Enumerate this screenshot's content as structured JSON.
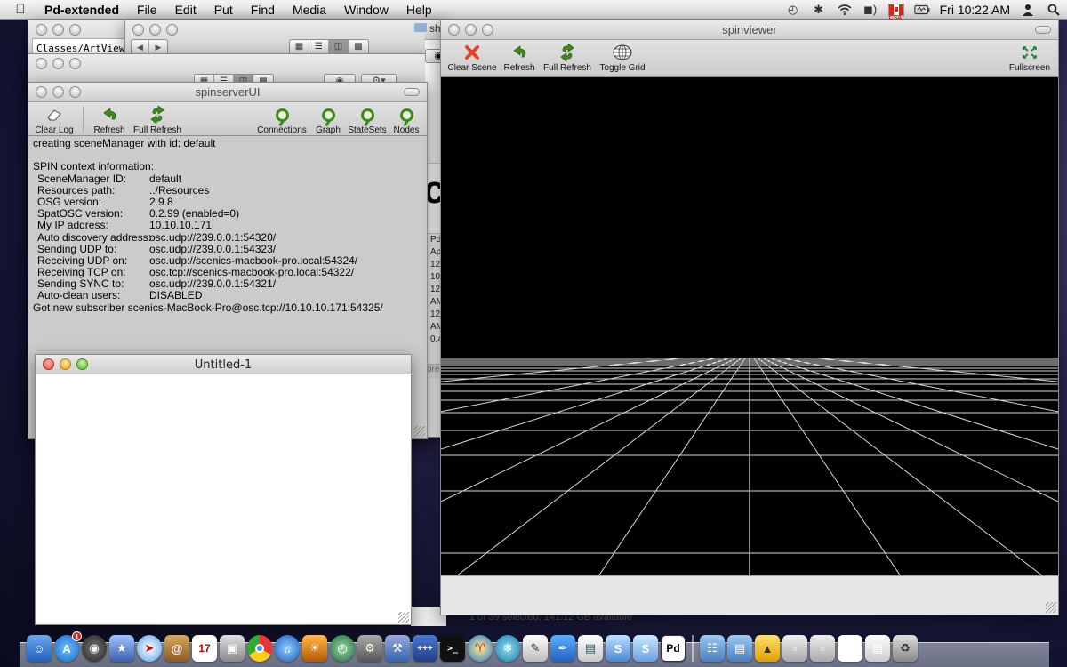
{
  "menubar": {
    "app_name": "Pd-extended",
    "items": [
      "File",
      "Edit",
      "Put",
      "Find",
      "Media",
      "Window",
      "Help"
    ],
    "clock": "Fri 10:22 AM",
    "flag_label": "CSA"
  },
  "finder_back": {
    "tab_label": "Classes/ArtView",
    "sidebar_label": "sh"
  },
  "spinserver": {
    "title": "spinserverUI",
    "toolbar": {
      "clear_log": "Clear Log",
      "refresh": "Refresh",
      "full_refresh": "Full Refresh",
      "connections": "Connections",
      "graph": "Graph",
      "statesets": "StateSets",
      "nodes": "Nodes"
    },
    "log": {
      "line1": "creating sceneManager with id: default",
      "header": "SPIN context information:",
      "entries": [
        {
          "k": "SceneManager ID:",
          "v": "default"
        },
        {
          "k": "Resources path:",
          "v": "../Resources"
        },
        {
          "k": "OSG version:",
          "v": "2.9.8"
        },
        {
          "k": "SpatOSC version:",
          "v": "0.2.99 (enabled=0)"
        },
        {
          "k": "My IP address:",
          "v": "10.10.10.171"
        },
        {
          "k": "Auto discovery address:",
          "v": "osc.udp://239.0.0.1:54320/"
        },
        {
          "k": "Sending UDP to:",
          "v": "osc.udp://239.0.0.1:54323/"
        },
        {
          "k": "Receiving UDP on:",
          "v": "osc.udp://scenics-macbook-pro.local:54324/"
        },
        {
          "k": "Receiving TCP on:",
          "v": "osc.tcp://scenics-macbook-pro.local:54322/"
        },
        {
          "k": "Sending SYNC to:",
          "v": "osc.udp://239.0.0.1:54321/"
        },
        {
          "k": "Auto-clean users:",
          "v": "DISABLED"
        }
      ],
      "footer": "Got new subscriber scenics-MacBook-Pro@osc.tcp://10.10.10.171:54325/"
    }
  },
  "untitled": {
    "title": "Untitled-1"
  },
  "pd_window_fragment": {
    "big_letter": "c",
    "lines": [
      "Pd",
      "Ap",
      "12",
      "10",
      "12",
      "AM",
      "12",
      "AM",
      "0.4"
    ],
    "bottom_text": "ore"
  },
  "finder_status": "1 of 39 selected, 141.12 GB available",
  "spinviewer": {
    "title": "spinviewer",
    "toolbar": {
      "clear_scene": "Clear Scene",
      "refresh": "Refresh",
      "full_refresh": "Full Refresh",
      "toggle_grid": "Toggle Grid",
      "fullscreen": "Fullscreen"
    }
  },
  "dock": {
    "calendar_day": "17",
    "appstore_badge": "1",
    "pd_label": "Pd",
    "terminal_label": ">_",
    "pmask_label": "+++"
  },
  "colors": {
    "accent_green": "#3f8a1a",
    "clear_red": "#e0442a",
    "log_bg": "#cbcbcb",
    "viewport_bg": "#000000",
    "grid_line": "#d8d8d8"
  }
}
